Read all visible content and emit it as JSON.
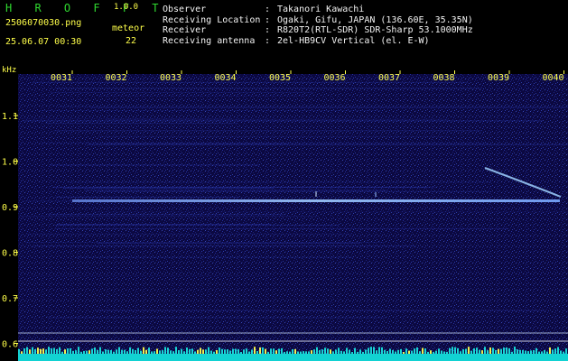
{
  "header": {
    "app_name": "H R O F F T",
    "version": "1.0.0",
    "filename": "2506070030.png",
    "timestamp": "25.06.07 00:30",
    "meteor_label": "meteor",
    "meteor_count": "22"
  },
  "info": [
    {
      "label": "Observer",
      "sep": ":",
      "value": "Takanori Kawachi"
    },
    {
      "label": "Receiving Location",
      "sep": ":",
      "value": "Ogaki, Gifu, JAPAN (136.60E, 35.35N)"
    },
    {
      "label": "Receiver",
      "sep": ":",
      "value": "R820T2(RTL-SDR) SDR-Sharp 53.1000MHz"
    },
    {
      "label": "Receiving antenna",
      "sep": ":",
      "value": "2el-HB9CV Vertical (el. E-W)"
    }
  ],
  "axis": {
    "y_unit": "kHz",
    "y_ticks": [
      "1.1",
      "1.0",
      "0.9",
      "0.8",
      "0.7",
      "0.6"
    ],
    "x_ticks": [
      "0031",
      "0032",
      "0033",
      "0034",
      "0035",
      "0036",
      "0037",
      "0038",
      "0039",
      "0040"
    ]
  },
  "colors": {
    "header_text": "#ffff4a",
    "logo": "#2fd92f",
    "info_text": "#f2f2f2",
    "background": "#000000",
    "noise_dark": "#0d0a40",
    "signal": "#a9d4ff"
  }
}
